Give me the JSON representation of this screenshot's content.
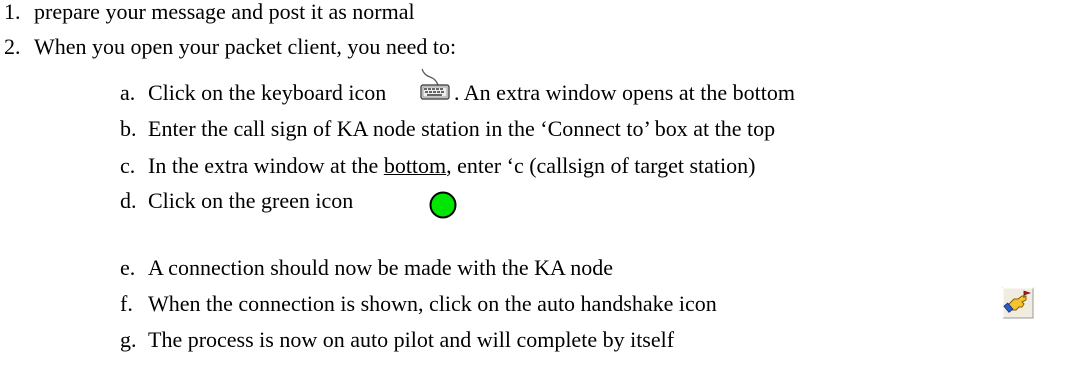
{
  "document": {
    "items": [
      {
        "marker": "1.",
        "text": "prepare your message and post it as normal"
      },
      {
        "marker": "2.",
        "text": "When you open your packet client, you need to:"
      }
    ],
    "subitems": [
      {
        "marker": "a.",
        "text_before": "Click on the keyboard icon",
        "text_after": ". An extra window opens at the bottom",
        "icon": "keyboard-icon"
      },
      {
        "marker": "b.",
        "text": "Enter the call sign of KA node station in the ‘Connect to’ box at the top"
      },
      {
        "marker": "c.",
        "text_before": "In the extra window at the ",
        "underlined": "bottom",
        "text_after": ", enter ‘c (callsign of target station)"
      },
      {
        "marker": "d.",
        "text": "Click on the green icon",
        "icon": "green-circle-icon"
      },
      {
        "marker": "e.",
        "text": "A connection should now be made with the KA node"
      },
      {
        "marker": "f.",
        "text": "When the connection is shown, click on the auto handshake icon",
        "icon": "auto-handshake-icon"
      },
      {
        "marker": "g.",
        "text": "The process is now on auto pilot and will complete by itself"
      }
    ],
    "colors": {
      "text": "#000000",
      "green_icon_fill": "#00e600",
      "green_icon_stroke": "#000000",
      "handshake_bg": "#f0ece0"
    }
  }
}
